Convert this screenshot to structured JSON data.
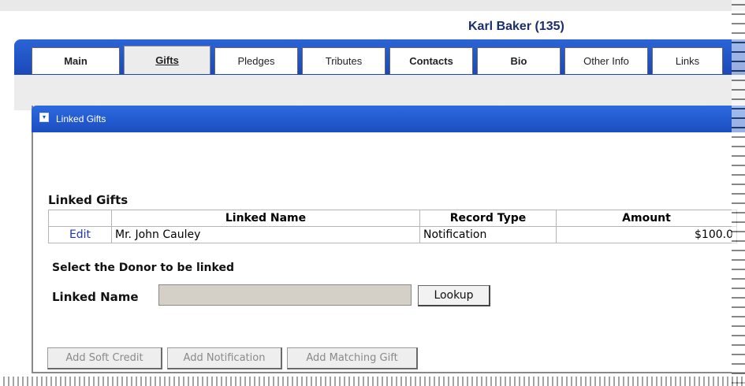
{
  "header": {
    "title": "Karl Baker (135)"
  },
  "tabs": [
    {
      "label": "Main",
      "active": false
    },
    {
      "label": "Gifts",
      "active": true
    },
    {
      "label": "Pledges",
      "active": false
    },
    {
      "label": "Tributes",
      "active": false
    },
    {
      "label": "Contacts",
      "active": false
    },
    {
      "label": "Bio",
      "active": false
    },
    {
      "label": "Other Info",
      "active": false
    },
    {
      "label": "Links",
      "active": false
    }
  ],
  "panel": {
    "title": "Linked Gifts",
    "collapse_icon": "collapse-icon"
  },
  "linked_gifts": {
    "heading": "Linked Gifts",
    "columns": [
      "",
      "Linked Name",
      "Record Type",
      "Amount"
    ],
    "rows": [
      {
        "action": "Edit",
        "name": "Mr. John Cauley",
        "record_type": "Notification",
        "amount": "$100.0"
      }
    ]
  },
  "donor_select": {
    "heading": "Select the Donor to be linked",
    "label": "Linked Name",
    "input_value": "",
    "lookup_label": "Lookup"
  },
  "actions": {
    "soft_credit": "Add Soft Credit",
    "notification": "Add Notification",
    "matching_gift": "Add Matching Gift"
  }
}
